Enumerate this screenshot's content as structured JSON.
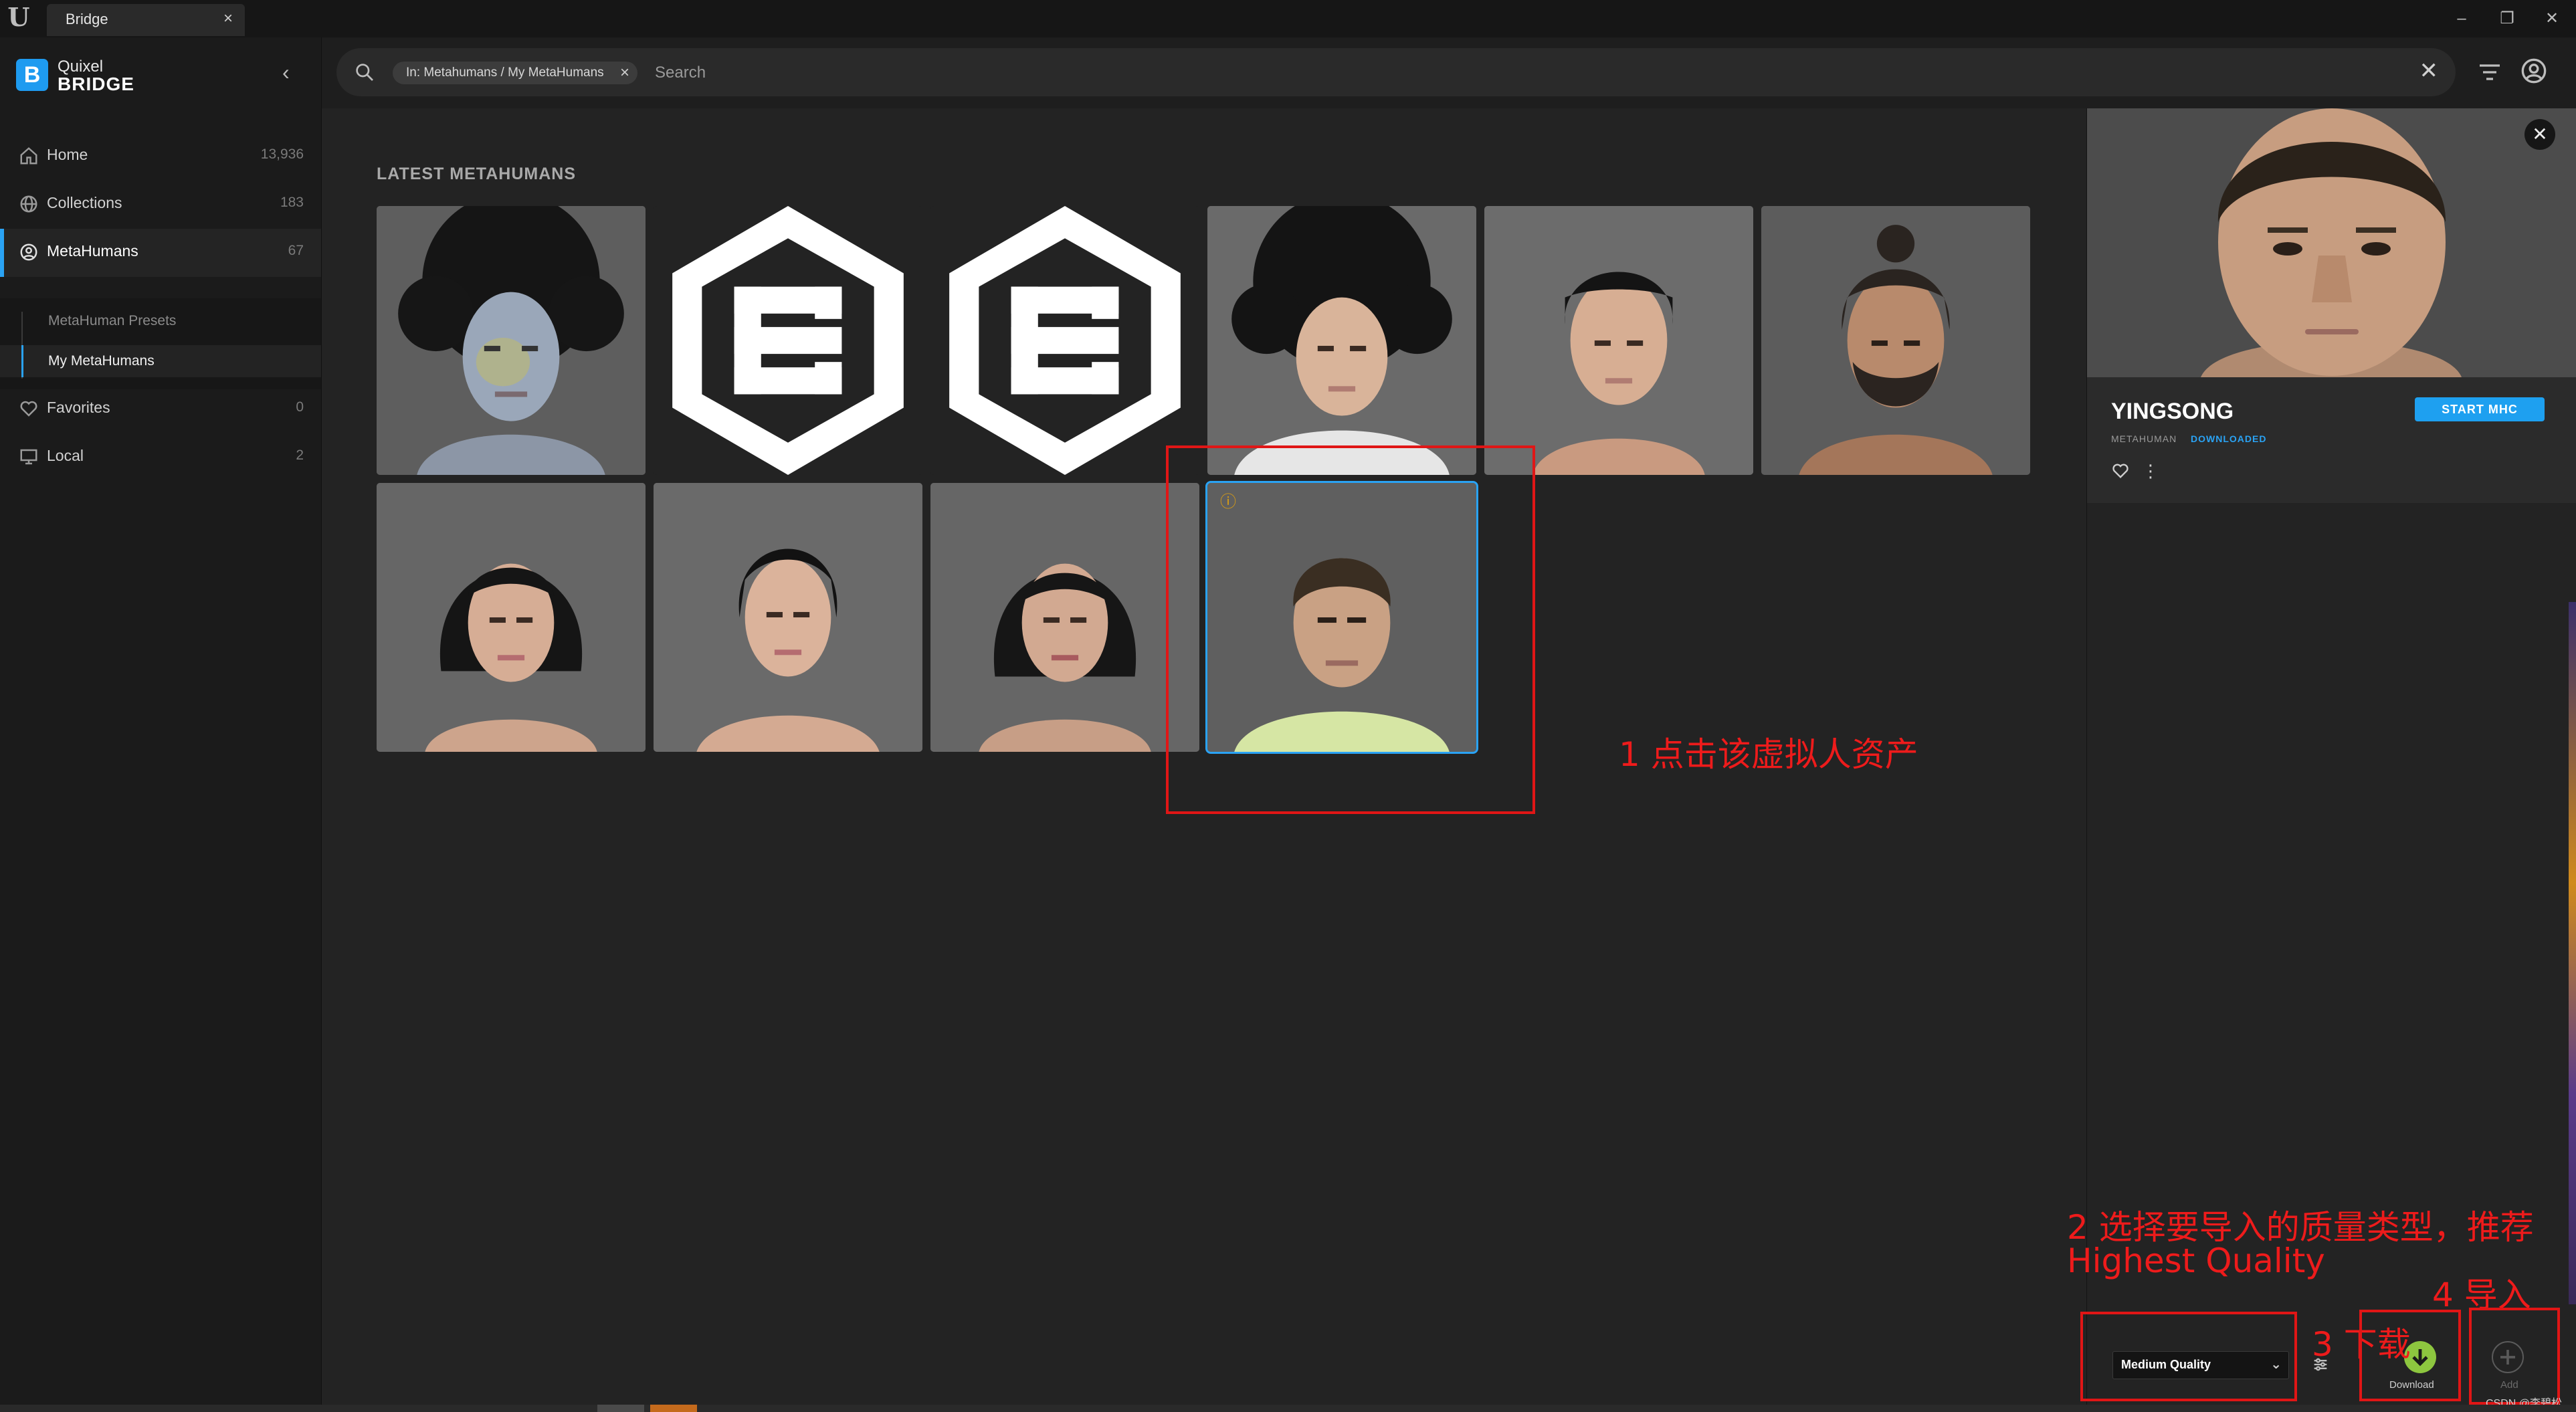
{
  "window": {
    "tab_title": "Bridge",
    "tab_close": "×",
    "controls": {
      "minimize": "–",
      "restore": "❐",
      "close": "✕"
    }
  },
  "brand": {
    "badge": "B",
    "line1": "Quixel",
    "line2": "BRIDGE",
    "collapse": "‹"
  },
  "sidebar": {
    "items": [
      {
        "label": "Home",
        "count": "13,936",
        "icon": "home-icon"
      },
      {
        "label": "Collections",
        "count": "183",
        "icon": "globe-icon"
      },
      {
        "label": "MetaHumans",
        "count": "67",
        "icon": "user-circle-icon"
      },
      {
        "label": "Favorites",
        "count": "0",
        "icon": "heart-icon"
      },
      {
        "label": "Local",
        "count": "2",
        "icon": "monitor-icon"
      }
    ],
    "sub_items": [
      {
        "label": "MetaHuman Presets"
      },
      {
        "label": "My MetaHumans"
      }
    ]
  },
  "search": {
    "chip": "In: Metahumans / My MetaHumans",
    "chip_close": "×",
    "placeholder": "Search",
    "clear": "✕"
  },
  "main": {
    "section_title": "LATEST METAHUMANS",
    "tiles": [
      {
        "kind": "afro-blue-skin"
      },
      {
        "kind": "metahuman-logo"
      },
      {
        "kind": "metahuman-logo"
      },
      {
        "kind": "afro-hoodie"
      },
      {
        "kind": "bangs-woman"
      },
      {
        "kind": "bearded-man"
      },
      {
        "kind": "bob-woman"
      },
      {
        "kind": "short-hair-woman"
      },
      {
        "kind": "bob-woman-2"
      },
      {
        "kind": "yingsong",
        "selected": true,
        "warning": "ⓘ"
      }
    ]
  },
  "detail": {
    "close": "✕",
    "name": "YINGSONG",
    "type": "METAHUMAN",
    "status": "DOWNLOADED",
    "start_button": "START MHC",
    "more": "⋮",
    "quality": "Medium Quality",
    "quality_chevron": "⌄",
    "download_label": "Download",
    "add_label": "Add"
  },
  "annotations": [
    {
      "text": "1 点击该虚拟人资产"
    },
    {
      "text": "2 选择要导入的质量类型，推荐"
    },
    {
      "text": "Highest Quality"
    },
    {
      "text": "3 下载"
    },
    {
      "text": "4 导入"
    }
  ],
  "watermark": "CSDN @李碧松",
  "colors": {
    "accent": "#2aa3f4",
    "download": "#8dc63f",
    "annotation": "#e01616",
    "background": "#232323",
    "sidebar": "#1b1b1b"
  }
}
